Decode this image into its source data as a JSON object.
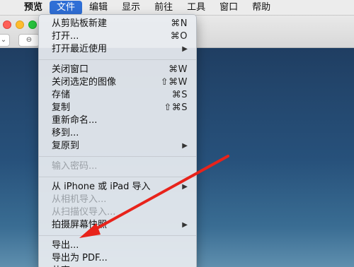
{
  "menubar": {
    "app": "预览",
    "items": [
      "文件",
      "编辑",
      "显示",
      "前往",
      "工具",
      "窗口",
      "帮助"
    ]
  },
  "menu": {
    "items": [
      {
        "label": "从剪贴板新建",
        "shortcut": "⌘N"
      },
      {
        "label": "打开...",
        "shortcut": "⌘O"
      },
      {
        "label": "打开最近使用",
        "submenu": "▶"
      },
      {
        "label": "关闭窗口",
        "shortcut": "⌘W"
      },
      {
        "label": "关闭选定的图像",
        "shortcut": "⇧⌘W"
      },
      {
        "label": "存储",
        "shortcut": "⌘S"
      },
      {
        "label": "复制",
        "shortcut": "⇧⌘S"
      },
      {
        "label": "重新命名..."
      },
      {
        "label": "移到..."
      },
      {
        "label": "复原到",
        "submenu": "▶"
      },
      {
        "label": "输入密码..."
      },
      {
        "label": "从 iPhone 或 iPad 导入",
        "submenu": "▶"
      },
      {
        "label": "从相机导入..."
      },
      {
        "label": "从扫描仪导入..."
      },
      {
        "label": "拍摄屏幕快照",
        "submenu": "▶"
      },
      {
        "label": "导出..."
      },
      {
        "label": "导出为 PDF..."
      },
      {
        "label": "共享",
        "submenu": "▶"
      }
    ]
  },
  "colors": {
    "menu_highlight": "#2f6fd6",
    "annotation_arrow": "#e8231b"
  }
}
